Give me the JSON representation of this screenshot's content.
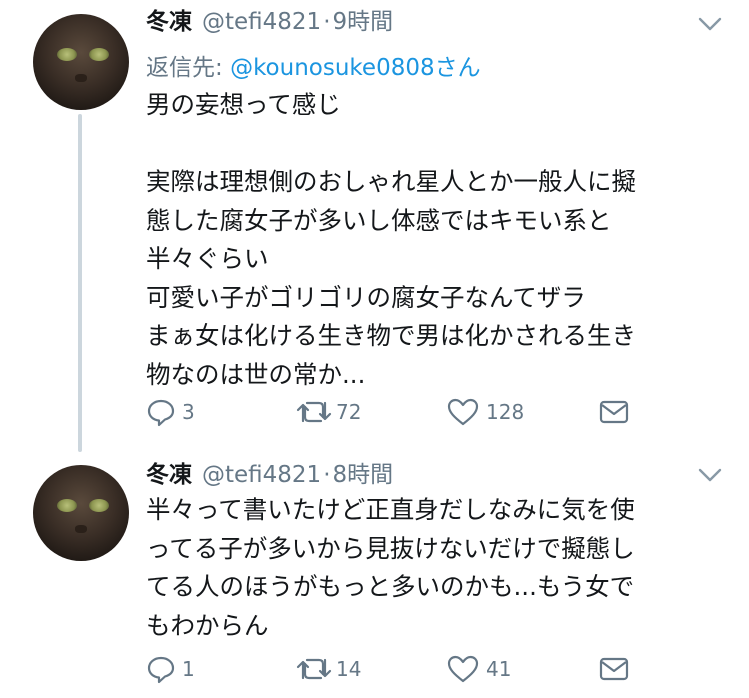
{
  "tweets": [
    {
      "name": "冬凍",
      "handle": "@tefi4821",
      "separator": "·",
      "time": "9時間",
      "reply_prefix": "返信先: ",
      "reply_mention": "@kounosuke0808",
      "reply_suffix": "さん",
      "text": "男の妄想って感じ\n\n実際は理想側のおしゃれ星人とか一般人に擬\n態した腐女子が多いし体感ではキモい系と\n半々ぐらい\n可愛い子がゴリゴリの腐女子なんてザラ\nまぁ女は化ける生き物で男は化かされる生き\n物なのは世の常か...",
      "replies": "3",
      "retweets": "72",
      "likes": "128"
    },
    {
      "name": "冬凍",
      "handle": "@tefi4821",
      "separator": "·",
      "time": "8時間",
      "text": "半々って書いたけど正直身だしなみに気を使\nってる子が多いから見抜けないだけで擬態し\nてる人のほうがもっと多いのかも...もう女で\nもわからん",
      "replies": "1",
      "retweets": "14",
      "likes": "41"
    }
  ],
  "icons": {
    "reply": "reply-icon",
    "retweet": "retweet-icon",
    "like": "heart-icon",
    "dm": "envelope-icon",
    "caret": "chevron-down-icon"
  },
  "colors": {
    "text": "#14171a",
    "secondary": "#657786",
    "link": "#1b95e0",
    "thread_line": "#ccd6dd"
  }
}
